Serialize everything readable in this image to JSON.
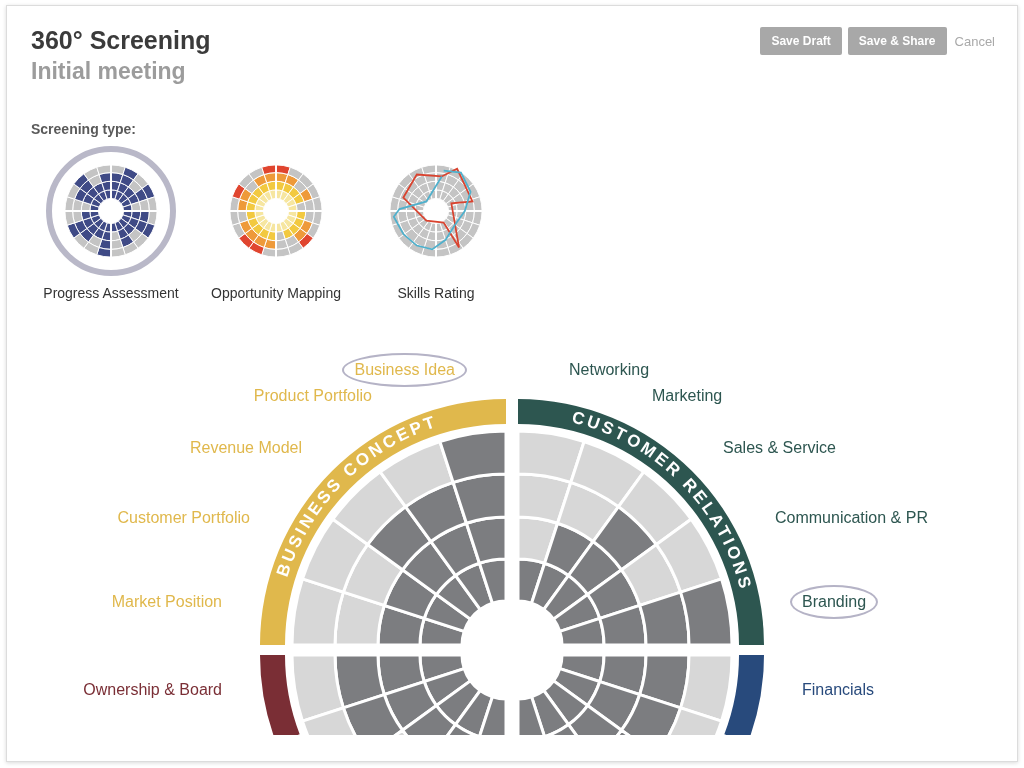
{
  "header": {
    "title": "360° Screening",
    "subtitle": "Initial meeting"
  },
  "actions": [
    {
      "label": "Save Draft",
      "kind": "button"
    },
    {
      "label": "Save & Share",
      "kind": "button"
    },
    {
      "label": "Cancel",
      "kind": "link"
    }
  ],
  "screening_types": {
    "label": "Screening type:",
    "options": [
      {
        "label": "Progress Assessment",
        "kind": "bars",
        "selected": true
      },
      {
        "label": "Opportunity Mapping",
        "kind": "heat",
        "selected": false
      },
      {
        "label": "Skills Rating",
        "kind": "lines",
        "selected": false
      }
    ]
  },
  "wheel": {
    "quadrants": [
      {
        "title": "BUSINESS CONCEPT",
        "color": "#e0b84c",
        "sectors": [
          {
            "label": "Market Position",
            "highlighted": false
          },
          {
            "label": "Customer Portfolio",
            "highlighted": false
          },
          {
            "label": "Revenue Model",
            "highlighted": false
          },
          {
            "label": "Product Portfolio",
            "highlighted": false
          },
          {
            "label": "Business Idea",
            "highlighted": true
          }
        ]
      },
      {
        "title": "CUSTOMER RELATIONS",
        "color": "#2d5650",
        "sectors": [
          {
            "label": "Networking",
            "highlighted": false
          },
          {
            "label": "Marketing",
            "highlighted": false
          },
          {
            "label": "Sales & Service",
            "highlighted": false
          },
          {
            "label": "Communication & PR",
            "highlighted": false
          },
          {
            "label": "Branding",
            "highlighted": true
          }
        ]
      },
      {
        "color": "#7a2e35",
        "sectors": [
          {
            "label": "Ownership & Board",
            "highlighted": false
          }
        ]
      },
      {
        "color": "#284a7c",
        "sectors": [
          {
            "label": "Financials",
            "highlighted": false
          }
        ]
      }
    ]
  }
}
